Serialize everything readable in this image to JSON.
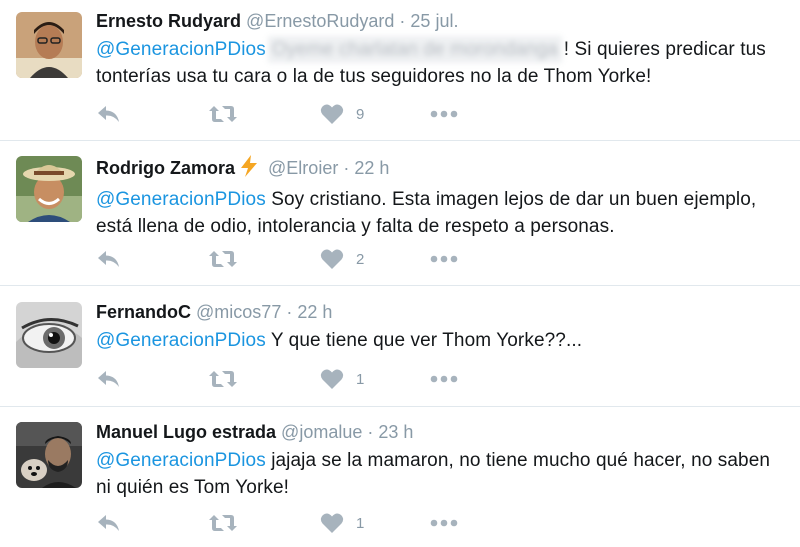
{
  "colors": {
    "accent": "#1b95e0",
    "muted": "#8899a6",
    "text": "#14171a",
    "divider": "#e1e8ed"
  },
  "tweets": [
    {
      "name": "Ernesto Rudyard",
      "handle": "@ErnestoRudyard",
      "sep": "·",
      "time": "25 jul.",
      "mention": "@GeneracionPDios",
      "blurred": "Oyeme charlatan de morondanga",
      "body": "! Si quieres predicar tus tonterías usa tu cara o la de tus seguidores no la de Thom Yorke!",
      "likes": "9",
      "icons": [
        "reply-icon",
        "retweet-icon",
        "heart-icon",
        "more-icon"
      ]
    },
    {
      "name": "Rodrigo Zamora",
      "handle": "@Elroier",
      "sep": "·",
      "time": "22 h",
      "mention": "@GeneracionPDios",
      "body": " Soy cristiano. Esta imagen lejos de dar un buen ejemplo, está llena de odio, intolerancia y falta de respeto a personas.",
      "likes": "2",
      "badge_icon": "lightning-icon"
    },
    {
      "name": "FernandoC",
      "handle": "@micos77",
      "sep": "·",
      "time": "22 h",
      "mention": "@GeneracionPDios",
      "body": " Y que tiene que ver Thom Yorke??...",
      "likes": "1"
    },
    {
      "name": "Manuel Lugo estrada",
      "handle": "@jomalue",
      "sep": "·",
      "time": "23 h",
      "mention": "@GeneracionPDios",
      "body": " jajaja se la mamaron, no tiene mucho qué hacer, no saben ni quién es Tom Yorke!",
      "likes": "1"
    }
  ]
}
